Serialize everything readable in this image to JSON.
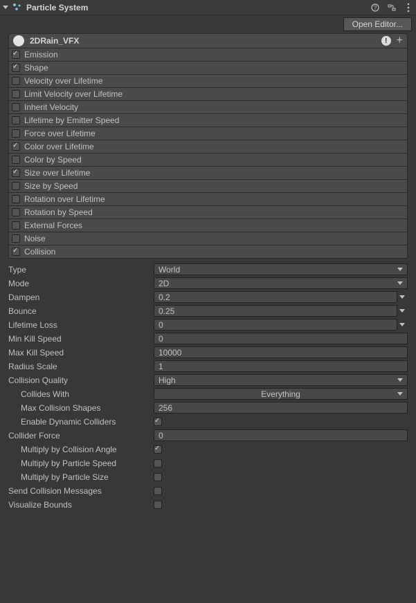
{
  "header": {
    "title": "Particle System",
    "open_editor": "Open Editor..."
  },
  "main_module": {
    "name": "2DRain_VFX"
  },
  "modules": [
    {
      "label": "Emission",
      "checked": true
    },
    {
      "label": "Shape",
      "checked": true
    },
    {
      "label": "Velocity over Lifetime",
      "checked": false
    },
    {
      "label": "Limit Velocity over Lifetime",
      "checked": false
    },
    {
      "label": "Inherit Velocity",
      "checked": false
    },
    {
      "label": "Lifetime by Emitter Speed",
      "checked": false
    },
    {
      "label": "Force over Lifetime",
      "checked": false
    },
    {
      "label": "Color over Lifetime",
      "checked": true
    },
    {
      "label": "Color by Speed",
      "checked": false
    },
    {
      "label": "Size over Lifetime",
      "checked": true
    },
    {
      "label": "Size by Speed",
      "checked": false
    },
    {
      "label": "Rotation over Lifetime",
      "checked": false
    },
    {
      "label": "Rotation by Speed",
      "checked": false
    },
    {
      "label": "External Forces",
      "checked": false
    },
    {
      "label": "Noise",
      "checked": false
    },
    {
      "label": "Collision",
      "checked": true
    }
  ],
  "collision": {
    "type_label": "Type",
    "type_value": "World",
    "mode_label": "Mode",
    "mode_value": "2D",
    "dampen_label": "Dampen",
    "dampen_value": "0.2",
    "bounce_label": "Bounce",
    "bounce_value": "0.25",
    "lifetime_loss_label": "Lifetime Loss",
    "lifetime_loss_value": "0",
    "min_kill_label": "Min Kill Speed",
    "min_kill_value": "0",
    "max_kill_label": "Max Kill Speed",
    "max_kill_value": "10000",
    "radius_scale_label": "Radius Scale",
    "radius_scale_value": "1",
    "quality_label": "Collision Quality",
    "quality_value": "High",
    "collides_with_label": "Collides With",
    "collides_with_value": "Everything",
    "max_shapes_label": "Max Collision Shapes",
    "max_shapes_value": "256",
    "dynamic_colliders_label": "Enable Dynamic Colliders",
    "dynamic_colliders_value": true,
    "collider_force_label": "Collider Force",
    "collider_force_value": "0",
    "mult_angle_label": "Multiply by Collision Angle",
    "mult_angle_value": true,
    "mult_pspeed_label": "Multiply by Particle Speed",
    "mult_pspeed_value": false,
    "mult_psize_label": "Multiply by Particle Size",
    "mult_psize_value": false,
    "send_messages_label": "Send Collision Messages",
    "send_messages_value": false,
    "visualize_label": "Visualize Bounds",
    "visualize_value": false
  }
}
